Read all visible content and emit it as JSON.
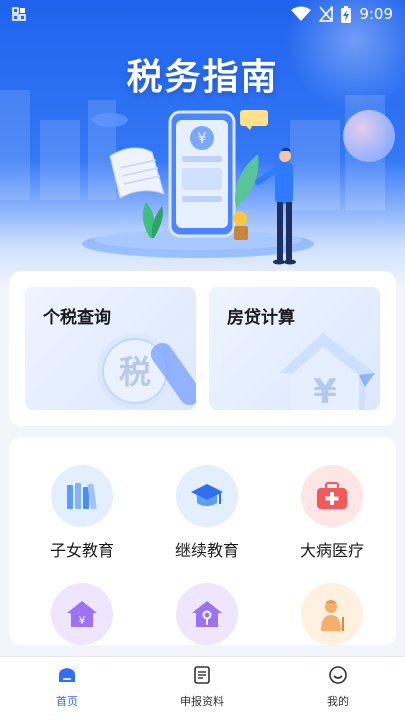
{
  "status_bar": {
    "time": "9:09",
    "icons": [
      "qr-icon",
      "wifi-icon",
      "no-sim-icon",
      "battery-charging-icon"
    ]
  },
  "hero": {
    "title": "税务指南",
    "phone_symbol": "¥"
  },
  "queries": [
    {
      "label": "个税查询",
      "emblem": "税"
    },
    {
      "label": "房贷计算",
      "emblem": "¥"
    }
  ],
  "services": [
    {
      "label": "子女教育",
      "icon": "books-icon"
    },
    {
      "label": "继续教育",
      "icon": "graduation-cap-icon"
    },
    {
      "label": "大病医疗",
      "icon": "medical-kit-icon"
    },
    {
      "label": "",
      "icon": "house-yuan-icon"
    },
    {
      "label": "",
      "icon": "house-key-icon"
    },
    {
      "label": "",
      "icon": "elderly-icon"
    }
  ],
  "nav": [
    {
      "label": "首页",
      "icon": "home-icon",
      "active": true
    },
    {
      "label": "申报资料",
      "icon": "document-icon",
      "active": false
    },
    {
      "label": "我的",
      "icon": "smile-icon",
      "active": false
    }
  ],
  "colors": {
    "primary": "#2f6ff0",
    "hero_top": "#1f63ee",
    "hero_mid": "#3478f6",
    "background": "#f3f5fa"
  }
}
